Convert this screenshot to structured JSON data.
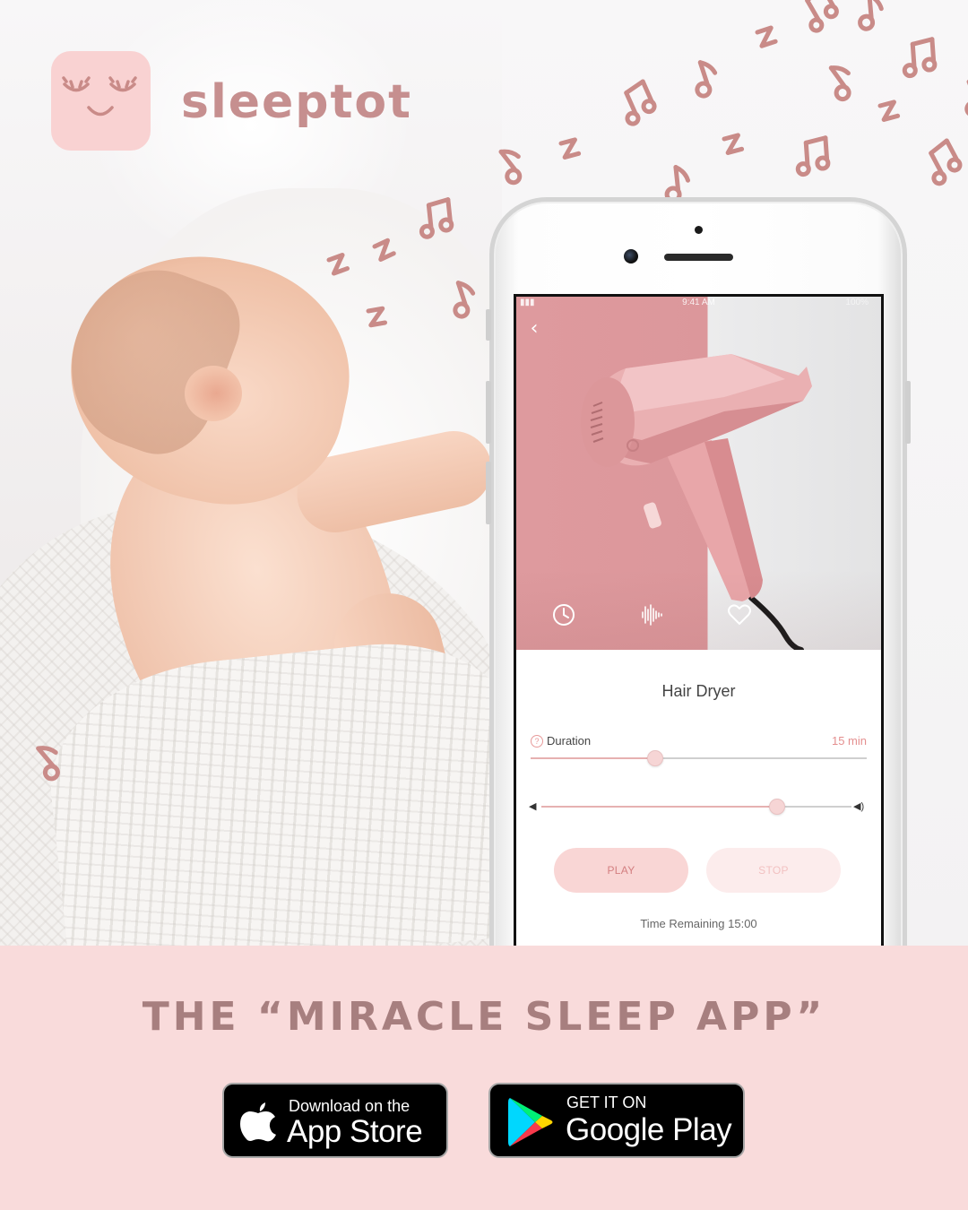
{
  "brand": {
    "name": "sleeptot",
    "color": "#c68f8f",
    "logo_bg": "#f9d2d2"
  },
  "app_screen": {
    "status": {
      "time": "9:41 AM",
      "battery": "100%"
    },
    "sound_title": "Hair Dryer",
    "duration": {
      "label": "Duration",
      "value": "15 min",
      "slider_fraction": 0.37
    },
    "volume": {
      "slider_fraction": 0.76
    },
    "buttons": {
      "play": "PLAY",
      "stop": "STOP"
    },
    "time_remaining": "Time Remaining 15:00",
    "icons": [
      "back-arrow-icon",
      "clock-icon",
      "waveform-icon",
      "heart-icon",
      "help-icon",
      "volume-low-icon",
      "volume-high-icon"
    ]
  },
  "tagline": "THE “MIRACLE SLEEP APP”",
  "stores": {
    "apple": {
      "small": "Download on the",
      "big": "App Store"
    },
    "google": {
      "small": "GET IT ON",
      "big": "Google Play"
    }
  },
  "colors": {
    "banner": "#f9dbdb",
    "tagline": "#a77f7f",
    "accent_pink": "#de9a9e",
    "play_button": "#f9d6d5"
  }
}
